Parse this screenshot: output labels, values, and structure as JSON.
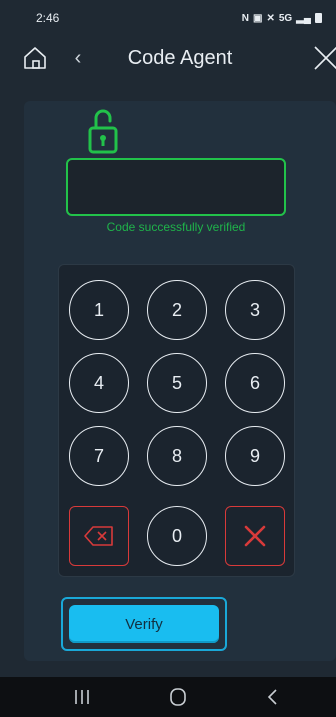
{
  "status_bar": {
    "time": "2:46",
    "network": "5G"
  },
  "header": {
    "title": "Code Agent",
    "back_glyph": "‹"
  },
  "icons": {
    "home": "home-icon",
    "back": "chevron-left-icon",
    "close": "close-icon",
    "unlock": "unlocked-padlock-icon",
    "backspace": "backspace-icon",
    "clear": "clear-x-icon"
  },
  "code_input": {
    "value": ""
  },
  "status_message": "Code successfully verified",
  "keypad": {
    "keys": [
      "1",
      "2",
      "3",
      "4",
      "5",
      "6",
      "7",
      "8",
      "9",
      "0"
    ]
  },
  "verify_label": "Verify",
  "colors": {
    "background": "#1f2933",
    "panel": "#22303d",
    "success": "#22c24a",
    "danger": "#d83a3a",
    "accent": "#19bdf0"
  }
}
